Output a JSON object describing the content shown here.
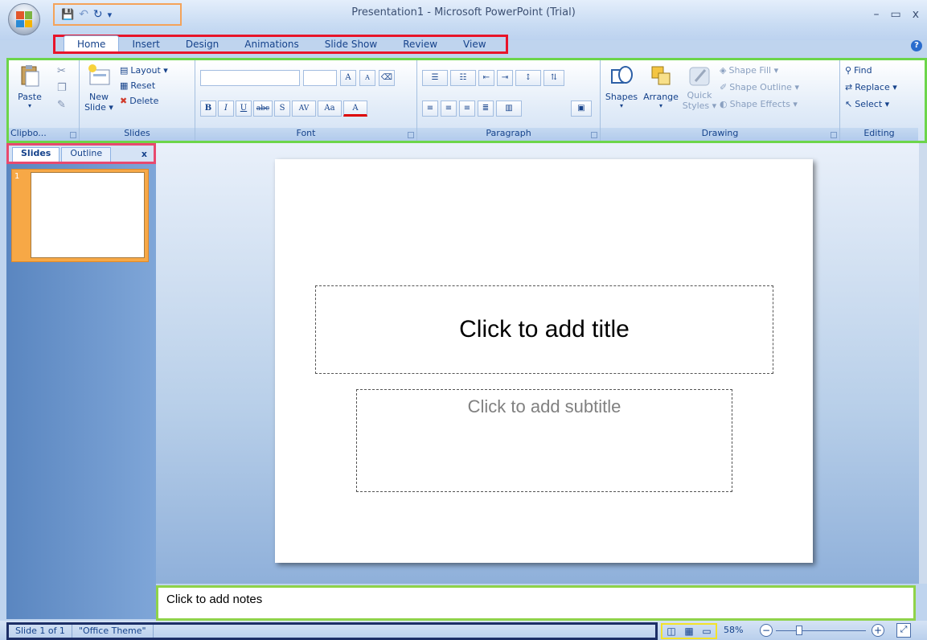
{
  "window": {
    "title": "Presentation1 - Microsoft PowerPoint (Trial)",
    "minimize": "–",
    "maximize": "▭",
    "close": "x"
  },
  "qat": {
    "save": "💾",
    "undo": "↶",
    "redo": "↻",
    "customize": "▾"
  },
  "tabs": [
    {
      "label": "Home"
    },
    {
      "label": "Insert"
    },
    {
      "label": "Design"
    },
    {
      "label": "Animations"
    },
    {
      "label": "Slide Show"
    },
    {
      "label": "Review"
    },
    {
      "label": "View"
    }
  ],
  "ribbon": {
    "clipboard": {
      "paste": "Paste",
      "label": "Clipbo..."
    },
    "slides": {
      "new_slide_1": "New",
      "new_slide_2": "Slide ▾",
      "layout": "Layout ▾",
      "reset": "Reset",
      "delete": "Delete",
      "label": "Slides"
    },
    "font": {
      "label": "Font",
      "grow": "A",
      "shrink": "A",
      "bold": "B",
      "italic": "I",
      "underline": "U",
      "strike": "abc",
      "shadow": "S",
      "spacing": "AV",
      "case": "Aa",
      "color": "A"
    },
    "paragraph": {
      "label": "Paragraph"
    },
    "drawing": {
      "shapes": "Shapes",
      "arrange": "Arrange",
      "quick_1": "Quick",
      "quick_2": "Styles ▾",
      "fill": "Shape Fill ▾",
      "outline": "Shape Outline ▾",
      "effects": "Shape Effects ▾",
      "label": "Drawing"
    },
    "editing": {
      "find": "Find",
      "replace": "Replace ▾",
      "select": "Select ▾",
      "label": "Editing"
    }
  },
  "pane": {
    "tab_slides": "Slides",
    "tab_outline": "Outline",
    "close": "x",
    "thumb_number": "1"
  },
  "slide": {
    "title_placeholder": "Click to add title",
    "subtitle_placeholder": "Click to add subtitle"
  },
  "notes": {
    "placeholder": "Click to add notes"
  },
  "status": {
    "slide_info": "Slide 1 of 1",
    "theme": "\"Office Theme\"",
    "zoom": "58%",
    "zoom_level": 0.26
  },
  "colors": {
    "accent": "#15428b",
    "ribbon_bg": "#dbe7f6"
  }
}
